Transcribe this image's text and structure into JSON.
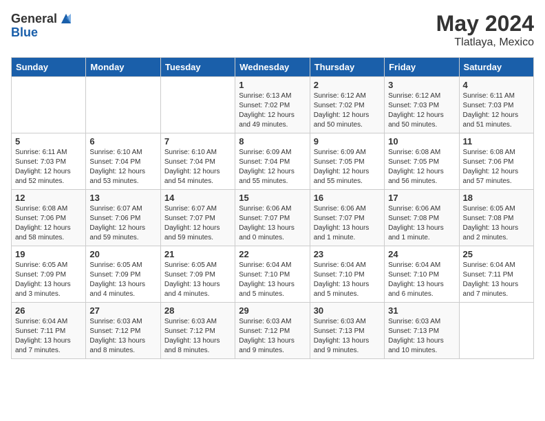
{
  "header": {
    "logo_general": "General",
    "logo_blue": "Blue",
    "month": "May 2024",
    "location": "Tlatlaya, Mexico"
  },
  "days_of_week": [
    "Sunday",
    "Monday",
    "Tuesday",
    "Wednesday",
    "Thursday",
    "Friday",
    "Saturday"
  ],
  "weeks": [
    [
      {
        "day": "",
        "info": ""
      },
      {
        "day": "",
        "info": ""
      },
      {
        "day": "",
        "info": ""
      },
      {
        "day": "1",
        "info": "Sunrise: 6:13 AM\nSunset: 7:02 PM\nDaylight: 12 hours\nand 49 minutes."
      },
      {
        "day": "2",
        "info": "Sunrise: 6:12 AM\nSunset: 7:02 PM\nDaylight: 12 hours\nand 50 minutes."
      },
      {
        "day": "3",
        "info": "Sunrise: 6:12 AM\nSunset: 7:03 PM\nDaylight: 12 hours\nand 50 minutes."
      },
      {
        "day": "4",
        "info": "Sunrise: 6:11 AM\nSunset: 7:03 PM\nDaylight: 12 hours\nand 51 minutes."
      }
    ],
    [
      {
        "day": "5",
        "info": "Sunrise: 6:11 AM\nSunset: 7:03 PM\nDaylight: 12 hours\nand 52 minutes."
      },
      {
        "day": "6",
        "info": "Sunrise: 6:10 AM\nSunset: 7:04 PM\nDaylight: 12 hours\nand 53 minutes."
      },
      {
        "day": "7",
        "info": "Sunrise: 6:10 AM\nSunset: 7:04 PM\nDaylight: 12 hours\nand 54 minutes."
      },
      {
        "day": "8",
        "info": "Sunrise: 6:09 AM\nSunset: 7:04 PM\nDaylight: 12 hours\nand 55 minutes."
      },
      {
        "day": "9",
        "info": "Sunrise: 6:09 AM\nSunset: 7:05 PM\nDaylight: 12 hours\nand 55 minutes."
      },
      {
        "day": "10",
        "info": "Sunrise: 6:08 AM\nSunset: 7:05 PM\nDaylight: 12 hours\nand 56 minutes."
      },
      {
        "day": "11",
        "info": "Sunrise: 6:08 AM\nSunset: 7:06 PM\nDaylight: 12 hours\nand 57 minutes."
      }
    ],
    [
      {
        "day": "12",
        "info": "Sunrise: 6:08 AM\nSunset: 7:06 PM\nDaylight: 12 hours\nand 58 minutes."
      },
      {
        "day": "13",
        "info": "Sunrise: 6:07 AM\nSunset: 7:06 PM\nDaylight: 12 hours\nand 59 minutes."
      },
      {
        "day": "14",
        "info": "Sunrise: 6:07 AM\nSunset: 7:07 PM\nDaylight: 12 hours\nand 59 minutes."
      },
      {
        "day": "15",
        "info": "Sunrise: 6:06 AM\nSunset: 7:07 PM\nDaylight: 13 hours\nand 0 minutes."
      },
      {
        "day": "16",
        "info": "Sunrise: 6:06 AM\nSunset: 7:07 PM\nDaylight: 13 hours\nand 1 minute."
      },
      {
        "day": "17",
        "info": "Sunrise: 6:06 AM\nSunset: 7:08 PM\nDaylight: 13 hours\nand 1 minute."
      },
      {
        "day": "18",
        "info": "Sunrise: 6:05 AM\nSunset: 7:08 PM\nDaylight: 13 hours\nand 2 minutes."
      }
    ],
    [
      {
        "day": "19",
        "info": "Sunrise: 6:05 AM\nSunset: 7:09 PM\nDaylight: 13 hours\nand 3 minutes."
      },
      {
        "day": "20",
        "info": "Sunrise: 6:05 AM\nSunset: 7:09 PM\nDaylight: 13 hours\nand 4 minutes."
      },
      {
        "day": "21",
        "info": "Sunrise: 6:05 AM\nSunset: 7:09 PM\nDaylight: 13 hours\nand 4 minutes."
      },
      {
        "day": "22",
        "info": "Sunrise: 6:04 AM\nSunset: 7:10 PM\nDaylight: 13 hours\nand 5 minutes."
      },
      {
        "day": "23",
        "info": "Sunrise: 6:04 AM\nSunset: 7:10 PM\nDaylight: 13 hours\nand 5 minutes."
      },
      {
        "day": "24",
        "info": "Sunrise: 6:04 AM\nSunset: 7:10 PM\nDaylight: 13 hours\nand 6 minutes."
      },
      {
        "day": "25",
        "info": "Sunrise: 6:04 AM\nSunset: 7:11 PM\nDaylight: 13 hours\nand 7 minutes."
      }
    ],
    [
      {
        "day": "26",
        "info": "Sunrise: 6:04 AM\nSunset: 7:11 PM\nDaylight: 13 hours\nand 7 minutes."
      },
      {
        "day": "27",
        "info": "Sunrise: 6:03 AM\nSunset: 7:12 PM\nDaylight: 13 hours\nand 8 minutes."
      },
      {
        "day": "28",
        "info": "Sunrise: 6:03 AM\nSunset: 7:12 PM\nDaylight: 13 hours\nand 8 minutes."
      },
      {
        "day": "29",
        "info": "Sunrise: 6:03 AM\nSunset: 7:12 PM\nDaylight: 13 hours\nand 9 minutes."
      },
      {
        "day": "30",
        "info": "Sunrise: 6:03 AM\nSunset: 7:13 PM\nDaylight: 13 hours\nand 9 minutes."
      },
      {
        "day": "31",
        "info": "Sunrise: 6:03 AM\nSunset: 7:13 PM\nDaylight: 13 hours\nand 10 minutes."
      },
      {
        "day": "",
        "info": ""
      }
    ]
  ]
}
